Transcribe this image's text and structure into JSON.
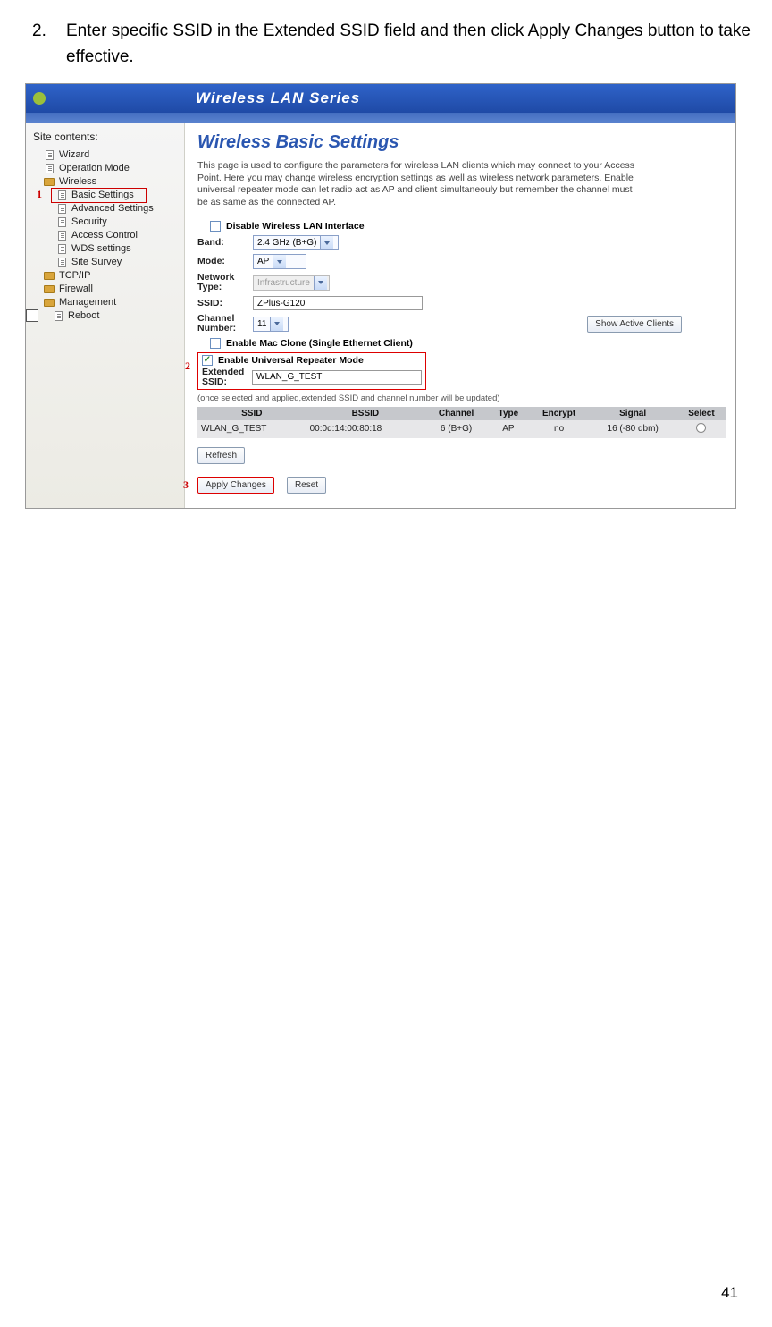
{
  "instruction": {
    "number": "2.",
    "text": "Enter specific SSID in the Extended SSID field and then click Apply Changes button to take effective."
  },
  "titlebar": {
    "title": "Wireless LAN Series"
  },
  "sidebar": {
    "header": "Site contents:",
    "items": [
      {
        "label": "Wizard",
        "type": "doc",
        "indent": 1
      },
      {
        "label": "Operation Mode",
        "type": "doc",
        "indent": 1
      },
      {
        "label": "Wireless",
        "type": "folder",
        "indent": 1
      },
      {
        "label": "Basic Settings",
        "type": "doc",
        "indent": 2,
        "highlight": true,
        "num": "1"
      },
      {
        "label": "Advanced Settings",
        "type": "doc",
        "indent": 2
      },
      {
        "label": "Security",
        "type": "doc",
        "indent": 2
      },
      {
        "label": "Access Control",
        "type": "doc",
        "indent": 2
      },
      {
        "label": "WDS settings",
        "type": "doc",
        "indent": 2
      },
      {
        "label": "Site Survey",
        "type": "doc",
        "indent": 2
      },
      {
        "label": "TCP/IP",
        "type": "folder",
        "indent": 1
      },
      {
        "label": "Firewall",
        "type": "folder",
        "indent": 1
      },
      {
        "label": "Management",
        "type": "folder",
        "indent": 1
      },
      {
        "label": "Reboot",
        "type": "doc",
        "indent": 1
      }
    ]
  },
  "content": {
    "heading": "Wireless Basic Settings",
    "description": "This page is used to configure the parameters for wireless LAN clients which may connect to your Access Point. Here you may change wireless encryption settings as well as wireless network parameters. Enable universal repeater mode can let radio act as AP and client simultaneouly but remember the channel must be as same as the connected AP.",
    "disable_label": "Disable Wireless LAN Interface",
    "band_label": "Band:",
    "band_value": "2.4 GHz (B+G)",
    "mode_label": "Mode:",
    "mode_value": "AP",
    "nettype_label": "Network Type:",
    "nettype_value": "Infrastructure",
    "ssid_label": "SSID:",
    "ssid_value": "ZPlus-G120",
    "channel_label": "Channel Number:",
    "channel_value": "11",
    "show_active": "Show Active Clients",
    "macclone_label": "Enable Mac Clone (Single Ethernet Client)",
    "repeater_label": "Enable Universal Repeater Mode",
    "repeater_num": "2",
    "ext_ssid_label": "Extended SSID:",
    "ext_ssid_value": "WLAN_G_TEST",
    "note": "(once selected and applied,extended SSID and channel number will be updated)",
    "table": {
      "headers": [
        "SSID",
        "BSSID",
        "Channel",
        "Type",
        "Encrypt",
        "Signal",
        "Select"
      ],
      "row": [
        "WLAN_G_TEST",
        "00:0d:14:00:80:18",
        "6 (B+G)",
        "AP",
        "no",
        "16 (-80 dbm)",
        ""
      ]
    },
    "refresh": "Refresh",
    "apply": "Apply Changes",
    "reset": "Reset",
    "apply_num": "3"
  },
  "page_number": "41"
}
